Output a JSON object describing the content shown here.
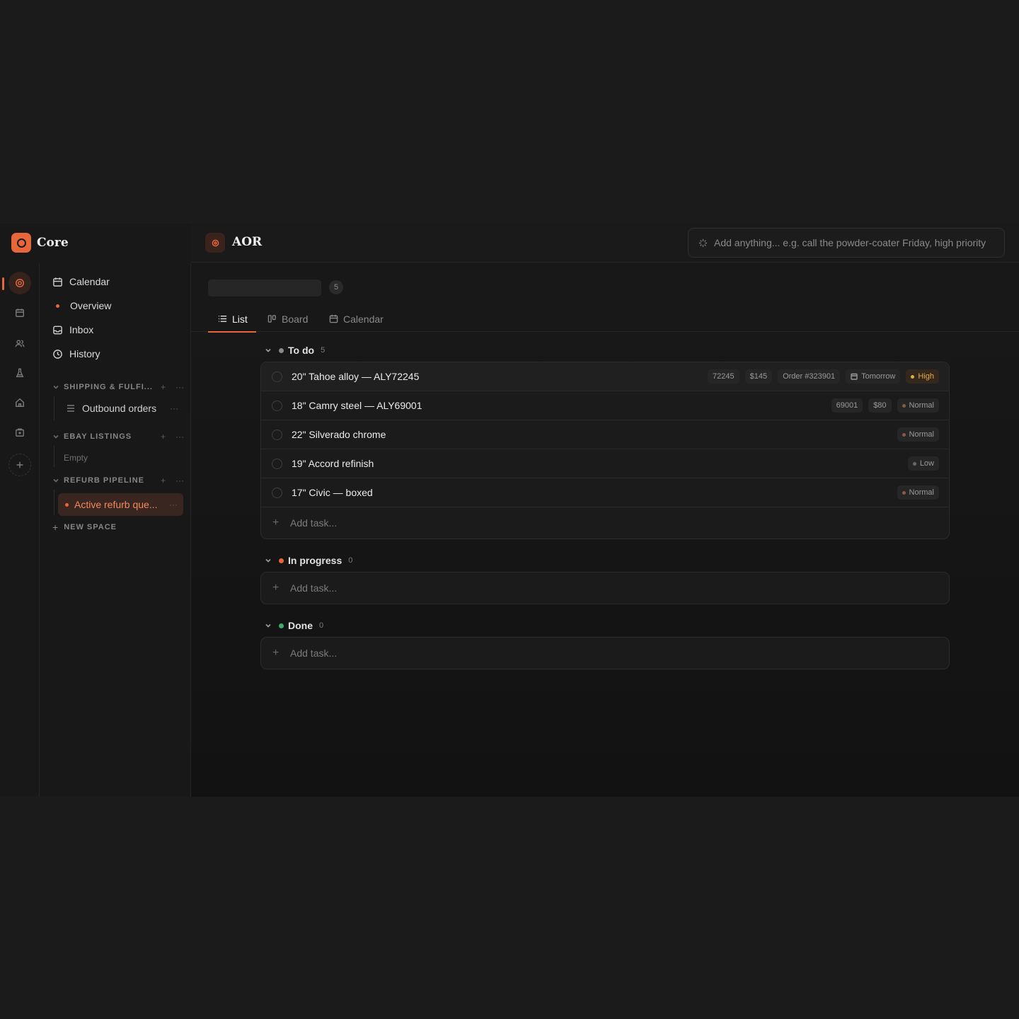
{
  "app": {
    "name": "Core"
  },
  "sidebar": {
    "nav": [
      {
        "label": "Calendar",
        "icon": "calendar-icon"
      },
      {
        "label": "Overview",
        "icon": "dot"
      },
      {
        "label": "Inbox",
        "icon": "inbox-icon"
      },
      {
        "label": "History",
        "icon": "clock-icon"
      }
    ],
    "sections": [
      {
        "title": "SHIPPING & FULFI...",
        "items": [
          {
            "label": "Outbound orders"
          }
        ]
      },
      {
        "title": "EBAY LISTINGS",
        "empty_label": "Empty"
      },
      {
        "title": "REFURB PIPELINE",
        "items": [
          {
            "label": "Active refurb que..."
          }
        ]
      }
    ],
    "new_space": "NEW SPACE"
  },
  "header": {
    "space_title": "AOR",
    "quick_add_placeholder": "Add anything...  e.g. call the powder-coater Friday, high priority"
  },
  "list": {
    "count": "5",
    "tabs": [
      {
        "label": "List"
      },
      {
        "label": "Board"
      },
      {
        "label": "Calendar"
      }
    ],
    "active_tab": "List"
  },
  "groups": [
    {
      "name": "To do",
      "count": "5",
      "color": "#8a8a8a",
      "tasks": [
        {
          "title": "20\" Tahoe alloy — ALY72245",
          "chips": [
            "72245",
            "$145",
            "Order #323901"
          ],
          "due": "Tomorrow",
          "priority": "High"
        },
        {
          "title": "18\" Camry steel — ALY69001",
          "chips": [
            "69001",
            "$80"
          ],
          "priority": "Normal"
        },
        {
          "title": "22\" Silverado chrome",
          "priority": "Normal"
        },
        {
          "title": "19\" Accord refinish",
          "priority": "Low"
        },
        {
          "title": "17\" Civic — boxed",
          "priority": "Normal"
        }
      ],
      "add_label": "Add task..."
    },
    {
      "name": "In progress",
      "count": "0",
      "color": "#e8673a",
      "add_label": "Add task..."
    },
    {
      "name": "Done",
      "count": "0",
      "color": "#3fae6a",
      "add_label": "Add task..."
    }
  ],
  "colors": {
    "accent": "#e8673a",
    "background": "#181818",
    "high_priority": "#e6a94a"
  }
}
